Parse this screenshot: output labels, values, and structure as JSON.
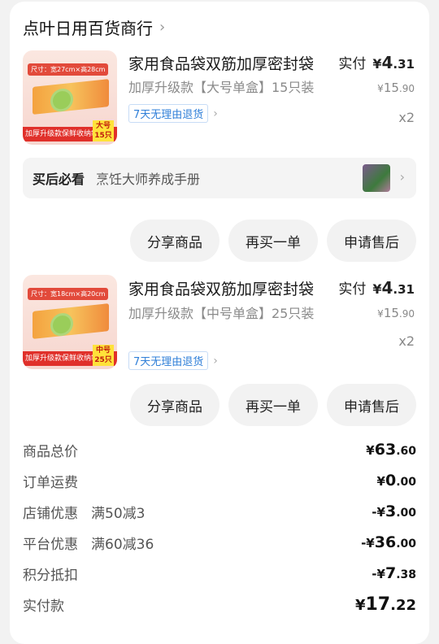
{
  "shop": {
    "name": "点叶日用百货商行",
    "chevron": "›"
  },
  "items": [
    {
      "thumb": {
        "tag": "尺寸：宽27cm×高28cm",
        "strip": "加厚升级款保鲜收纳袋",
        "size_top": "大号",
        "size_bottom": "15只"
      },
      "title": "家用食品袋双筋加厚密封袋",
      "spec": "加厚升级款【大号单盒】15只装",
      "badge": "7天无理由退货",
      "paid_label": "实付",
      "paid_cur": "¥",
      "paid_int": "4",
      "paid_dec": ".31",
      "orig_cur": "¥",
      "orig_int": "15",
      "orig_dec": ".90",
      "qty": "x2"
    },
    {
      "thumb": {
        "tag": "尺寸：宽18cm×高20cm",
        "strip": "加厚升级款保鲜收纳袋",
        "size_top": "中号",
        "size_bottom": "25只"
      },
      "title": "家用食品袋双筋加厚密封袋",
      "spec": "加厚升级款【中号单盒】25只装",
      "badge": "7天无理由退货",
      "paid_label": "实付",
      "paid_cur": "¥",
      "paid_int": "4",
      "paid_dec": ".31",
      "orig_cur": "¥",
      "orig_int": "15",
      "orig_dec": ".90",
      "qty": "x2"
    }
  ],
  "must_read": {
    "label": "买后必看",
    "text": "烹饪大师养成手册"
  },
  "actions": {
    "share": "分享商品",
    "rebuy": "再买一单",
    "aftersale": "申请售后"
  },
  "summary": {
    "goods_total": {
      "label": "商品总价",
      "sign": "",
      "cur": "¥",
      "int": "63",
      "dec": ".60"
    },
    "shipping": {
      "label": "订单运费",
      "sign": "",
      "cur": "¥",
      "int": "0",
      "dec": ".00"
    },
    "shop_discount": {
      "label": "店铺优惠",
      "sub": "满50减3",
      "sign": "-",
      "cur": "¥",
      "int": "3",
      "dec": ".00"
    },
    "platform_discount": {
      "label": "平台优惠",
      "sub": "满60减36",
      "sign": "-",
      "cur": "¥",
      "int": "36",
      "dec": ".00"
    },
    "points": {
      "label": "积分抵扣",
      "sign": "-",
      "cur": "¥",
      "int": "7",
      "dec": ".38"
    },
    "paid": {
      "label": "实付款",
      "sign": "",
      "cur": "¥",
      "int": "17",
      "dec": ".22"
    }
  }
}
